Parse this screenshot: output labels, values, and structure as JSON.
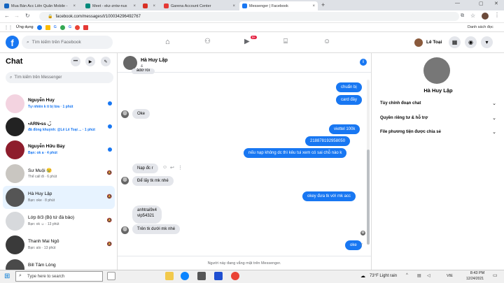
{
  "browser": {
    "tabs": [
      {
        "label": "Mua Bán Acc Liên Quân Mobile -",
        "color": "#1565c0"
      },
      {
        "label": "Meet - ekz-zntw-nux",
        "color": "#00897b"
      },
      {
        "label": "",
        "color": "#d93025"
      },
      {
        "label": "Garena Account Center",
        "color": "#e53935"
      },
      {
        "label": "Messenger | Facebook",
        "color": "#1877f2"
      }
    ],
    "url": "facebook.com/messages/t/100034296492767",
    "bookmarks_label": "Ứng dụng",
    "reading_list": "Danh sách đọc",
    "bookmark_colors": [
      "#1877f2",
      "#fbbc05",
      "#34a853",
      "#ea4335",
      "#4285f4",
      "#e53935"
    ],
    "bookmark_letters": [
      "G",
      "G"
    ]
  },
  "fb": {
    "logo": "f",
    "search_placeholder": "Tìm kiếm trên Facebook",
    "notif_badge": "9+",
    "user_name": "Lê Toại"
  },
  "chat": {
    "title": "Chat",
    "search_placeholder": "Tìm kiếm trên Messenger",
    "items": [
      {
        "name": "Nguyễn Huy",
        "preview": "Tự nhiên k ti bị lừa · 1 phút",
        "unread": true,
        "avatar": "#f3d3e0"
      },
      {
        "name": "•ARN•ss ◡̈",
        "preview": "đã đồng khuỷnh: @Lê Lê Toại ... · 1 phút",
        "unread": true,
        "avatar": "#222"
      },
      {
        "name": "Nguyễn Hữu Bảy",
        "preview": "Bạn: ok a · 4 phút",
        "unread": true,
        "avatar": "#8e1d2c"
      },
      {
        "name": "Sư Muội 😢",
        "preview": "Thể call đi · 6 phút",
        "unread": false,
        "avatar": "#c9c6c1"
      },
      {
        "name": "Hà Huy Lập",
        "preview": "Bạn: oke · 8 phút",
        "unread": false,
        "avatar": "#555"
      },
      {
        "name": "Lớp 8/3 (Bộ tứ đá bảo)",
        "preview": "Bạn: ok ☺ · 13 phút",
        "unread": false,
        "avatar": "#d7d9dc"
      },
      {
        "name": "Thanh Mai Ngô",
        "preview": "Bạn: alo · 13 phút",
        "unread": false,
        "avatar": "#3a3a3a"
      },
      {
        "name": "Bill Tâm Lòng",
        "preview": "",
        "unread": false,
        "avatar": "#4a4a4a"
      }
    ]
  },
  "conversation": {
    "name": "Hà Huy Lập",
    "status": "& ",
    "partial_top": "ảđỡ rồi",
    "messages_me_top": [
      "chuẩn bị",
      "card đây"
    ],
    "msg_them_1": "Oke",
    "messages_me_mid": [
      "viettel 100k",
      "218878192958050",
      "nếu nạp không dc thì kêu tui xem có sai chỗ nào k"
    ],
    "msg_them_2": "Nạp đc r",
    "msg_them_3": "Để lấy tk mk nhé",
    "msg_me_4": "okey đưa tk với mk acc",
    "msg_them_5": "anhtrai9x4\nvip54321",
    "msg_them_5a": "anhtrai9x4",
    "msg_them_5b": "vip54321",
    "msg_them_6": "Trên tk dưới mk nhé",
    "msg_me_7": "oke",
    "composer_note": "Người này đang vắng mặt trên Messenger."
  },
  "info": {
    "name": "Hà Huy Lập",
    "rows": [
      "Tùy chỉnh đoạn chat",
      "Quyền riêng tư & hỗ trợ",
      "File phương tiện được chia sẻ"
    ]
  },
  "taskbar": {
    "search": "Type here to search",
    "weather": "73°F  Light rain",
    "lang": "VIE",
    "time": "8:43 PM",
    "date": "12/24/2021"
  }
}
